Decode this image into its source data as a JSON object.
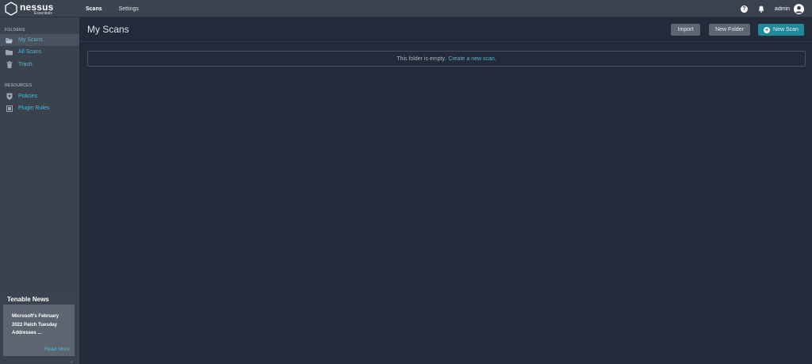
{
  "app": {
    "logo_name": "nessus",
    "logo_sub": "Essentials"
  },
  "nav": {
    "scans": "Scans",
    "settings": "Settings"
  },
  "user": {
    "name": "admin",
    "help_glyph": "?"
  },
  "sidebar": {
    "folders_label": "FOLDERS",
    "folders": [
      {
        "label": "My Scans",
        "icon": "folder-open-icon",
        "active": true
      },
      {
        "label": "All Scans",
        "icon": "folder-icon",
        "active": false
      },
      {
        "label": "Trash",
        "icon": "trash-icon",
        "active": false
      }
    ],
    "resources_label": "RESOURCES",
    "resources": [
      {
        "label": "Policies",
        "icon": "shield-icon"
      },
      {
        "label": "Plugin Rules",
        "icon": "plugin-rules-icon"
      }
    ]
  },
  "news": {
    "title": "Tenable News",
    "headline": "Microsoft's February 2022 Patch Tuesday Addresses ...",
    "read_more": "Read More",
    "collapse_glyph": "«"
  },
  "main": {
    "title": "My Scans",
    "import_label": "Import",
    "new_folder_label": "New Folder",
    "new_scan_label": "New Scan",
    "empty_text": "This folder is empty.",
    "empty_link": "Create a new scan."
  },
  "colors": {
    "accent": "#4fb8d6",
    "primary_button": "#1f8a9c",
    "background": "#232b3a",
    "sidebar": "#3a424e"
  }
}
